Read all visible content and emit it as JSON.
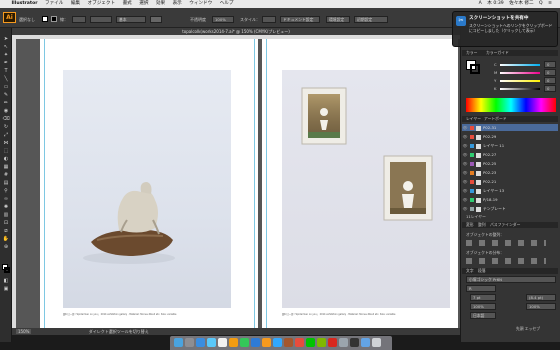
{
  "menubar": {
    "apple": "",
    "app_name": "Illustrator",
    "items": [
      "ファイル",
      "編集",
      "オブジェクト",
      "書式",
      "選択",
      "効果",
      "表示",
      "ウィンドウ",
      "ヘルプ"
    ],
    "right_items": [
      "A",
      "木 0:39",
      "佐々木 修二",
      "Q",
      "≡"
    ]
  },
  "control": {
    "logo": "Ai",
    "no_selection": "選択なし",
    "stroke_label": "線：",
    "stroke_preset": "基本",
    "opacity_label": "不透明度",
    "opacity_value": "100%",
    "style_label": "スタイル：",
    "doc_setup": "ドキュメント設定",
    "prefs": "環境設定",
    "workspace": "初期設定"
  },
  "document": {
    "tab_title": "topalcolk(works2014-7.ai* @ 150% (CMYK/プレビュー)",
    "caption_left": "図6 巳一郎「Spiderman on you」 2014 exhibition gallery · Material: Stone+Wood etc. Size: variable",
    "caption_right": "図6 巳一郎「Spiderman on you」 2014 exhibition gallery · Material: Stone+Wood etc. Size: variable",
    "status_zoom": "150%",
    "status_text": "ダイレクト選択ツールを切り替え"
  },
  "notification": {
    "icon": "✂",
    "title": "スクリーンショットを共有中",
    "body": "スクリーンショットへのリンクをクリップボードにコピーしました（クリックして表示）"
  },
  "panels": {
    "tab_color": "カラー",
    "tab_guide": "カラーガイド",
    "channels": [
      "C",
      "M",
      "Y",
      "K"
    ],
    "values": [
      "0",
      "0",
      "0",
      "0"
    ],
    "tab_layers": "レイヤー",
    "tab_artboards": "アートボード",
    "layers": [
      {
        "name": "P02-31",
        "color": "#e74c3c"
      },
      {
        "name": "P02-29",
        "color": "#e74c3c"
      },
      {
        "name": "レイヤー 11",
        "color": "#3498db"
      },
      {
        "name": "P02-27",
        "color": "#2ecc71"
      },
      {
        "name": "P02-25",
        "color": "#9b59b6"
      },
      {
        "name": "P02-23",
        "color": "#e67e22"
      },
      {
        "name": "P02-21",
        "color": "#e74c3c"
      },
      {
        "name": "レイヤー 13",
        "color": "#3498db"
      },
      {
        "name": "P/18-19",
        "color": "#2ecc71"
      },
      {
        "name": "テンプレート",
        "color": "#95a5a6"
      }
    ],
    "layers_count": "11レイヤー",
    "tab_transform": "変形",
    "tab_align": "整列",
    "tab_pathfinder": "パスファインダー",
    "align_objects": "オブジェクトの整列：",
    "distribute_objects": "オブジェクトの分布：",
    "tab_char": "文字",
    "tab_para": "段落",
    "font_name": "小塚ゴシック Pr6N",
    "font_style": "R",
    "font_size": "7 pt",
    "leading": "(8.4 pt)",
    "zoom_a": "100%",
    "zoom_b": "100%",
    "lang": "日本語",
    "bottom_label": "先頭 エッセブ"
  },
  "dock": {
    "icons": [
      {
        "name": "finder",
        "color": "#4aa3df"
      },
      {
        "name": "launchpad",
        "color": "#8e8e93"
      },
      {
        "name": "safari",
        "color": "#3b8de0"
      },
      {
        "name": "mail",
        "color": "#5ac8fa"
      },
      {
        "name": "calendar",
        "color": "#f2f2f2"
      },
      {
        "name": "photos",
        "color": "#f39c12"
      },
      {
        "name": "messages",
        "color": "#34c759"
      },
      {
        "name": "app-store",
        "color": "#2e7bd6"
      },
      {
        "name": "ai",
        "color": "#f79a1e"
      },
      {
        "name": "photoshop",
        "color": "#31a8ff"
      },
      {
        "name": "bridge",
        "color": "#a4572c"
      },
      {
        "name": "chrome",
        "color": "#e74c3c"
      },
      {
        "name": "line",
        "color": "#00c300"
      },
      {
        "name": "evernote",
        "color": "#7fb800"
      },
      {
        "name": "acrobat",
        "color": "#d8281e"
      },
      {
        "name": "preview",
        "color": "#9ba4ad"
      },
      {
        "name": "terminal",
        "color": "#333333"
      },
      {
        "name": "folder",
        "color": "#63a4e6"
      },
      {
        "name": "trash",
        "color": "#cfd2d6"
      }
    ]
  }
}
